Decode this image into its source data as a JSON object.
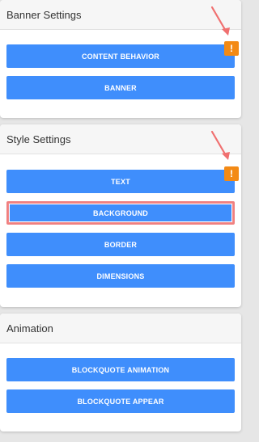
{
  "panels": [
    {
      "title": "Banner Settings",
      "buttons": [
        "CONTENT BEHAVIOR",
        "BANNER"
      ]
    },
    {
      "title": "Style Settings",
      "buttons": [
        "TEXT",
        "BACKGROUND",
        "BORDER",
        "DIMENSIONS"
      ]
    },
    {
      "title": "Animation",
      "buttons": [
        "BLOCKQUOTE ANIMATION",
        "BLOCKQUOTE APPEAR"
      ]
    }
  ],
  "warning_badge_text": "!",
  "colors": {
    "button_bg": "#3f8efc",
    "warning": "#f38a15",
    "highlight_border": "#f08080",
    "arrow": "#f07070"
  },
  "icons": {
    "warning": "exclamation-warning-icon",
    "annotation": "arrow-annotation-icon"
  }
}
